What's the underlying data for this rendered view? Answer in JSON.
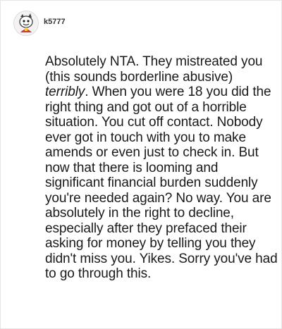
{
  "comment": {
    "author": "k5777",
    "avatar_icon": "cartoon-character-avatar",
    "text_before": "Absolutely NTA. They mistreated you (this sounds borderline abusive) ",
    "text_emphasis": "terribly",
    "text_after": ". When you were 18 you did the right thing and got out of a horrible situation. You cut off contact. Nobody ever got in touch with you to make amends or even just to check in. But now that there is looming and significant financial burden suddenly you're needed again? No way. You are absolutely in the right to decline, especially after they prefaced their asking for money by telling you they didn't miss you. Yikes. Sorry you've had to go through this."
  },
  "colors": {
    "text": "#1a1a1a",
    "username": "#333333",
    "background": "#ffffff"
  }
}
